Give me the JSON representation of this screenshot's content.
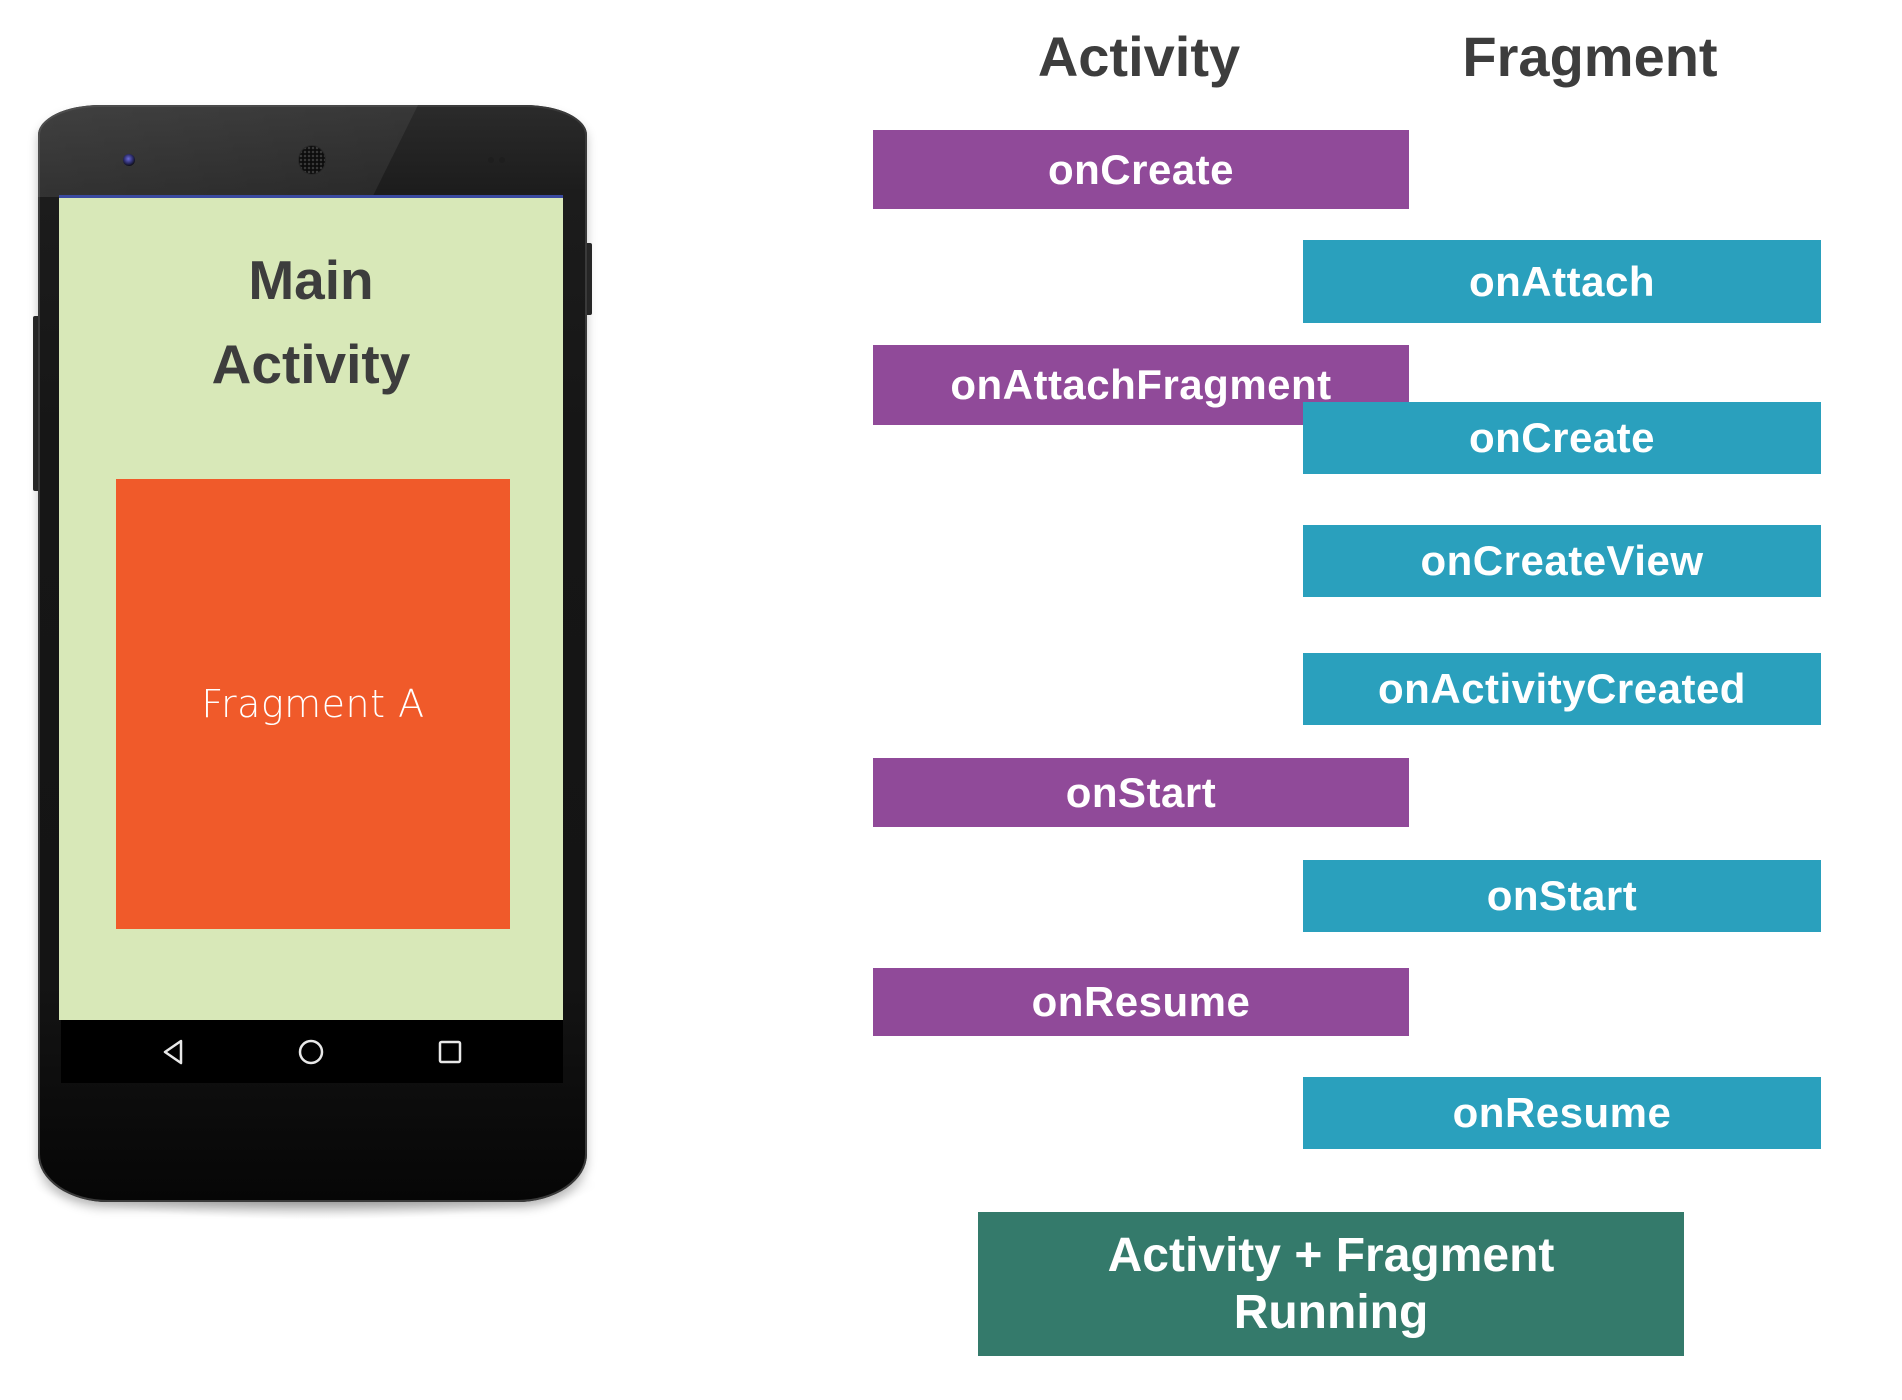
{
  "phone": {
    "screen_title_line1": "Main",
    "screen_title_line2": "Activity",
    "fragment_label": "Fragment A",
    "nav_buttons": [
      {
        "icon": "back-triangle-icon",
        "label": "Back"
      },
      {
        "icon": "home-circle-icon",
        "label": "Home"
      },
      {
        "icon": "recents-square-icon",
        "label": "Recents"
      }
    ],
    "colors": {
      "screen": "#d8e8b8",
      "fragment": "#f05a2a",
      "status_bar": "#3a4aa0"
    }
  },
  "diagram": {
    "headings": {
      "activity": "Activity",
      "fragment": "Fragment"
    },
    "steps": [
      {
        "owner": "activity",
        "label": "onCreate"
      },
      {
        "owner": "fragment",
        "label": "onAttach"
      },
      {
        "owner": "activity",
        "label": "onAttachFragment"
      },
      {
        "owner": "fragment",
        "label": "onCreate"
      },
      {
        "owner": "fragment",
        "label": "onCreateView"
      },
      {
        "owner": "fragment",
        "label": "onActivityCreated"
      },
      {
        "owner": "activity",
        "label": "onStart"
      },
      {
        "owner": "fragment",
        "label": "onStart"
      },
      {
        "owner": "activity",
        "label": "onResume"
      },
      {
        "owner": "fragment",
        "label": "onResume"
      }
    ],
    "result": {
      "line1": "Activity + Fragment",
      "line2": "Running"
    },
    "colors": {
      "activity": "#904a99",
      "fragment": "#2aa0bd",
      "result": "#347a6b",
      "heading_text": "#3d3d3d"
    }
  }
}
